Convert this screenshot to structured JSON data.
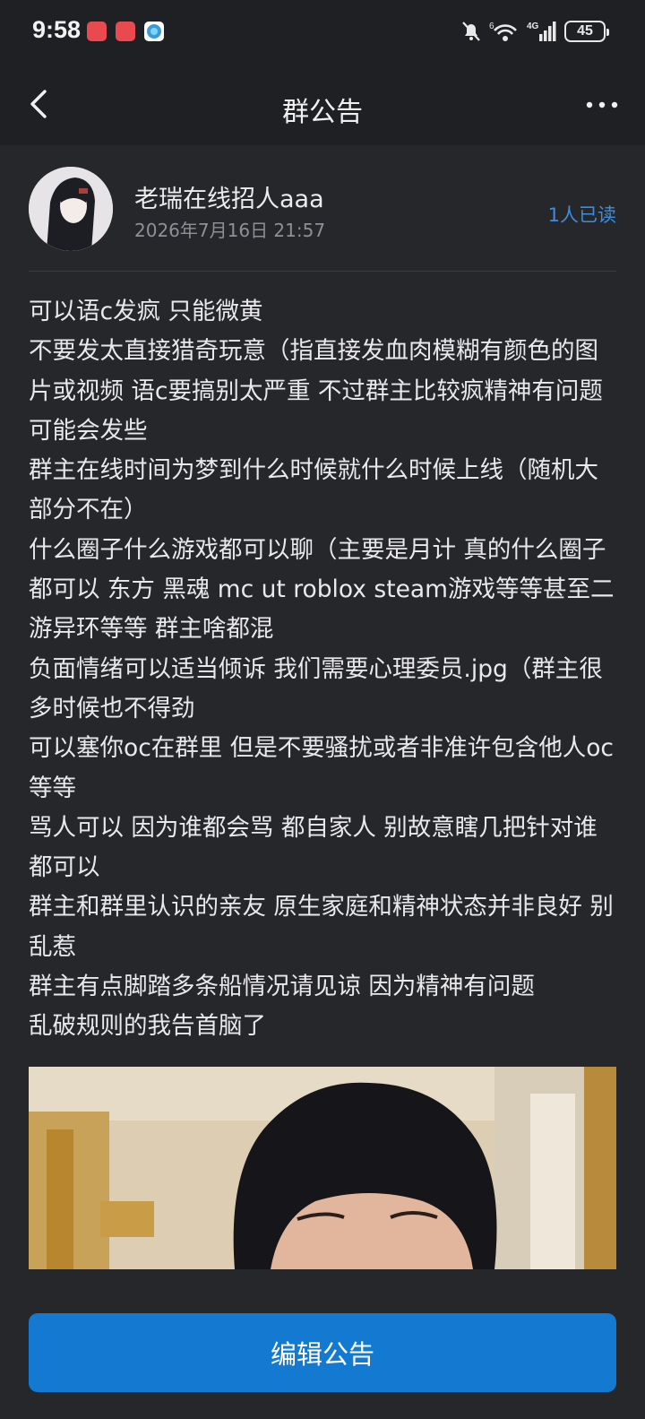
{
  "status_bar": {
    "time": "9:58",
    "network_label": "4G",
    "wifi_label": "6",
    "battery": "45"
  },
  "nav": {
    "title": "群公告"
  },
  "announcement": {
    "author_name": "老瑞在线招人aaa",
    "timestamp": "2026年7月16日 21:57",
    "read_count": "1人已读",
    "lines": [
      "可以语c发疯 只能微黄",
      "不要发太直接猎奇玩意（指直接发血肉模糊有颜色的图片或视频 语c要搞别太严重 不过群主比较疯精神有问题可能会发些",
      "群主在线时间为梦到什么时候就什么时候上线（随机大部分不在）",
      "什么圈子什么游戏都可以聊（主要是月计 真的什么圈子都可以 东方 黑魂 mc ut roblox steam游戏等等甚至二游异环等等 群主啥都混",
      "负面情绪可以适当倾诉 我们需要心理委员.jpg（群主很多时候也不得劲",
      "可以塞你oc在群里 但是不要骚扰或者非准许包含他人oc等等",
      "骂人可以 因为谁都会骂 都自家人 别故意瞎几把针对谁都可以",
      "群主和群里认识的亲友 原生家庭和精神状态并非良好 别乱惹",
      "群主有点脚踏多条船情况请见谅 因为精神有问题",
      "乱破规则的我告首脑了"
    ]
  },
  "actions": {
    "edit_label": "编辑公告"
  },
  "colors": {
    "background": "#26272b",
    "bar": "#1f2023",
    "accent": "#1479d0",
    "link": "#3e8ddc"
  }
}
